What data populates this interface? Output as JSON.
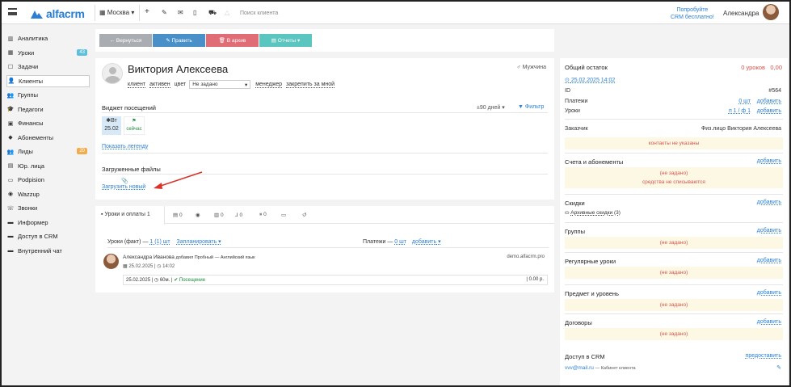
{
  "topbar": {
    "logo": "alfacrm",
    "branch": "Москва",
    "search_placeholder": "Поиск клиента",
    "promo_line1": "Попробуйте",
    "promo_line2": "CRM бесплатно!",
    "user": "Александра"
  },
  "sidebar": {
    "items": [
      {
        "icon": "chart-icon",
        "label": "Аналитика",
        "badge": ""
      },
      {
        "icon": "calendar-icon",
        "label": "Уроки",
        "badge": "43"
      },
      {
        "icon": "tasks-icon",
        "label": "Задачи",
        "badge": ""
      },
      {
        "icon": "user-icon",
        "label": "Клиенты",
        "badge": ""
      },
      {
        "icon": "group-icon",
        "label": "Группы",
        "badge": ""
      },
      {
        "icon": "teacher-icon",
        "label": "Педагоги",
        "badge": ""
      },
      {
        "icon": "money-icon",
        "label": "Финансы",
        "badge": ""
      },
      {
        "icon": "tag-icon",
        "label": "Абонементы",
        "badge": ""
      },
      {
        "icon": "leads-icon",
        "label": "Лиды",
        "badge": "20"
      },
      {
        "icon": "building-icon",
        "label": "Юр. лица",
        "badge": ""
      },
      {
        "icon": "doc-icon",
        "label": "Podpision",
        "badge": ""
      },
      {
        "icon": "whatsapp-icon",
        "label": "Wazzup",
        "badge": ""
      },
      {
        "icon": "phone-icon",
        "label": "Звонки",
        "badge": ""
      },
      {
        "icon": "info-icon",
        "label": "Информер",
        "badge": ""
      },
      {
        "icon": "lock-icon",
        "label": "Доступ в CRM",
        "badge": ""
      },
      {
        "icon": "chat-icon",
        "label": "Внутренний чат",
        "badge": ""
      }
    ]
  },
  "toolbar": {
    "back": "← Вернуться",
    "edit": "✎ Править",
    "archive": "🗑 В архив",
    "reports": "▤ Отчеты ▾"
  },
  "client": {
    "name": "Виктория Алексеева",
    "gender": "Мужчина",
    "tags": [
      "клиент",
      "активен",
      "цвет"
    ],
    "color_select": "Не задано",
    "manager": "менеджер",
    "assign": "закрепить за мной"
  },
  "widget": {
    "title": "Виджет посещений",
    "days": "±90 дней",
    "filter": "Фильтр",
    "day_name": "Вт",
    "day_date": "25.02",
    "now": "сейчас",
    "legend": "Показать легенду"
  },
  "files": {
    "title": "Загруженные файлы",
    "upload": "Загрузить новый"
  },
  "tabs": {
    "lessons": "Уроки и оплаты 1",
    "counts": [
      "0",
      "",
      "0",
      "0",
      "0"
    ]
  },
  "lessons": {
    "fact_label": "Уроки (факт) —",
    "fact_link": "1 (1) шт",
    "plan": "Запланировать",
    "payments_label": "Платежи —",
    "payments_link": "0 шт",
    "add": "добавить",
    "entry_user": "Александра Иванова",
    "entry_action": "добавил Пробный",
    "entry_subject": "— Английский язык",
    "entry_domain": "demo.alfacrm.pro",
    "entry_date": "25.02.2025",
    "entry_time": "14:02",
    "row_date": "25.02.2025",
    "row_dur": "60м.",
    "row_status": "Посещение",
    "row_sum": "0.00 р."
  },
  "right": {
    "balance_label": "Общий остаток",
    "balance_lessons": "0 уроков",
    "balance_sum": "0,00",
    "date_link": "25.02.2025 14:02",
    "id_label": "ID",
    "id_value": "#564",
    "payments_label": "Платежи",
    "payments_val": "0 шт",
    "payments_add": "добавить",
    "lessons_label": "Уроки",
    "lessons_val": "п 1 / ф 1",
    "lessons_add": "добавить",
    "customer_label": "Заказчик",
    "customer_val": "Физ.лицо Виктория Алексеева",
    "no_contacts": "контакты не указаны",
    "sections": [
      {
        "title": "Счета и абонементы",
        "add": "добавить",
        "lines": [
          "(не задано)",
          "средства не списываются"
        ],
        "extra": ""
      },
      {
        "title": "Скидки",
        "add": "добавить",
        "lines": [],
        "extra": "Архивные скидки (3)"
      },
      {
        "title": "Группы",
        "add": "добавить",
        "lines": [
          "(не задано)"
        ],
        "extra": ""
      },
      {
        "title": "Регулярные уроки",
        "add": "добавить",
        "lines": [
          "(не задано)"
        ],
        "extra": ""
      },
      {
        "title": "Предмет и уровень",
        "add": "добавить",
        "lines": [
          "(не задано)"
        ],
        "extra": ""
      },
      {
        "title": "Договоры",
        "add": "добавить",
        "lines": [
          "(не задано)"
        ],
        "extra": ""
      }
    ],
    "crm_title": "Доступ в CRM",
    "crm_link": "предоставить",
    "crm_email": "vvv@mail.ru",
    "crm_note": "— Кабинет клиента"
  },
  "colors": {
    "accent": "#2a7fd4",
    "back": "#a9adb2",
    "edit": "#4a90c8",
    "archive": "#e06c75",
    "reports": "#5bc5c0",
    "red": "#d9534f",
    "highlight": "#fcf8e3",
    "arrow": "#d9332a"
  }
}
